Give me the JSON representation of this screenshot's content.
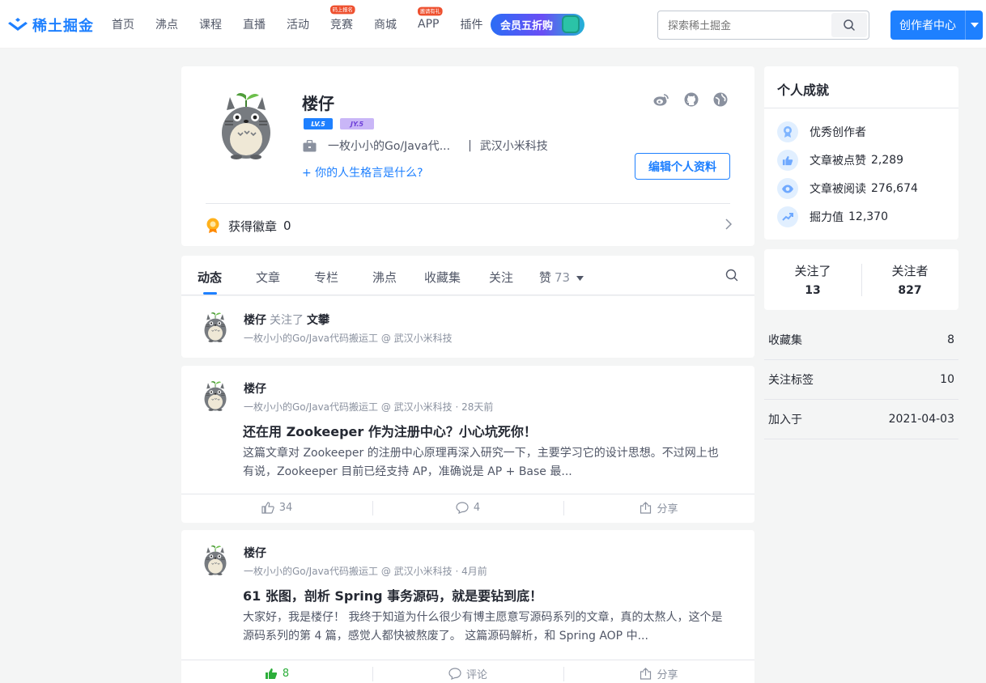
{
  "header": {
    "logo_text": "稀土掘金",
    "nav": [
      {
        "label": "首页",
        "badge": ""
      },
      {
        "label": "沸点",
        "badge": ""
      },
      {
        "label": "课程",
        "badge": ""
      },
      {
        "label": "直播",
        "badge": ""
      },
      {
        "label": "活动",
        "badge": ""
      },
      {
        "label": "竞赛",
        "badge": "码上报名"
      },
      {
        "label": "商城",
        "badge": ""
      },
      {
        "label": "APP",
        "badge": "邀请有礼"
      },
      {
        "label": "插件",
        "badge": ""
      }
    ],
    "vip_label": "会员五折购",
    "search_placeholder": "探索稀土掘金",
    "creator_label": "创作者中心"
  },
  "profile": {
    "name": "楼仔",
    "level_badge": "LV.5",
    "jy_badge": "JY.5",
    "job": "一枚小小的Go/Java代...",
    "separator": "|",
    "company": "武汉小米科技",
    "motto_prompt": "+ 你的人生格言是什么?",
    "edit_label": "编辑个人资料",
    "badges_label": "获得徽章",
    "badges_count": "0"
  },
  "tabs": {
    "items": [
      "动态",
      "文章",
      "专栏",
      "沸点",
      "收藏集",
      "关注",
      "赞"
    ],
    "like_count": "73"
  },
  "feed": [
    {
      "name": "楼仔",
      "action": "关注了",
      "target": "文攀",
      "meta": "一枚小小的Go/Java代码搬运工 @ 武汉小米科技"
    },
    {
      "name": "楼仔",
      "meta": "一枚小小的Go/Java代码搬运工 @ 武汉小米科技 · 28天前",
      "title": "还在用 Zookeeper 作为注册中心？小心坑死你！",
      "excerpt": "这篇文章对 Zookeeper 的注册中心原理再深入研究一下，主要学习它的设计思想。不过网上也有说，Zookeeper 目前已经支持 AP，准确说是 AP + Base 最...",
      "likes": "34",
      "comments": "4",
      "share": "分享"
    },
    {
      "name": "楼仔",
      "meta": "一枚小小的Go/Java代码搬运工 @ 武汉小米科技 · 4月前",
      "title": "61 张图，剖析 Spring 事务源码，就是要钻到底！",
      "excerpt": "大家好，我是楼仔！ 我终于知道为什么很少有博主愿意写源码系列的文章，真的太熬人，这个是源码系列的第 4 篇，感觉人都快被熬废了。 这篇源码解析，和 Spring AOP 中...",
      "likes": "8",
      "comments": "评论",
      "share": "分享"
    }
  ],
  "achievements": {
    "title": "个人成就",
    "rows": [
      {
        "label": "优秀创作者",
        "value": ""
      },
      {
        "label": "文章被点赞",
        "value": "2,289"
      },
      {
        "label": "文章被阅读",
        "value": "276,674"
      },
      {
        "label": "掘力值",
        "value": "12,370"
      }
    ]
  },
  "follow": {
    "following_label": "关注了",
    "following": "13",
    "followers_label": "关注者",
    "followers": "827"
  },
  "info": [
    {
      "label": "收藏集",
      "value": "8"
    },
    {
      "label": "关注标签",
      "value": "10"
    },
    {
      "label": "加入于",
      "value": "2021-04-03"
    }
  ],
  "colors": {
    "brand": "#1e80ff",
    "like_green": "#2cae3a",
    "text": "#252933",
    "muted": "#8a919f"
  }
}
